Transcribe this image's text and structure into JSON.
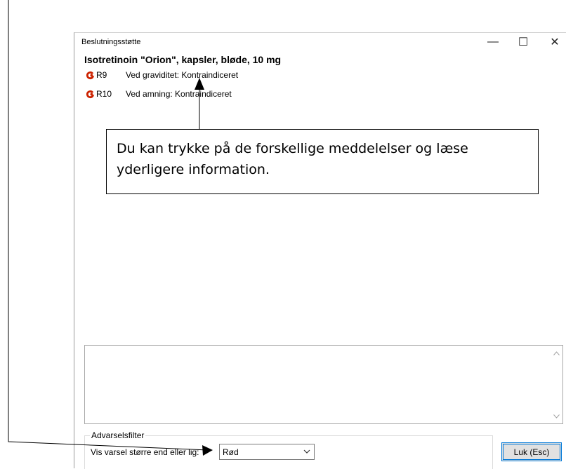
{
  "window": {
    "title": "Beslutningsstøtte",
    "minimize_glyph": "—",
    "maximize_glyph": "☐",
    "close_glyph": "✕"
  },
  "drug": {
    "name": "Isotretinoin \"Orion\", kapsler, bløde, 10 mg"
  },
  "alerts": [
    {
      "code": "R9",
      "text": "Ved graviditet: Kontraindiceret",
      "icon": "red-alert-icon"
    },
    {
      "code": "R10",
      "text": "Ved amning: Kontraindiceret",
      "icon": "red-alert-icon"
    }
  ],
  "filter": {
    "group_label": "Advarselsfilter",
    "label": "Vis varsel større end eller lig:",
    "selected": "Rød"
  },
  "buttons": {
    "close_label": "Luk (Esc)"
  },
  "callout": {
    "text": "Du kan trykke på de forskellige meddelelser og læse yderligere information."
  },
  "colors": {
    "alert_red": "#cc2200",
    "focus_blue": "#0078d7"
  }
}
